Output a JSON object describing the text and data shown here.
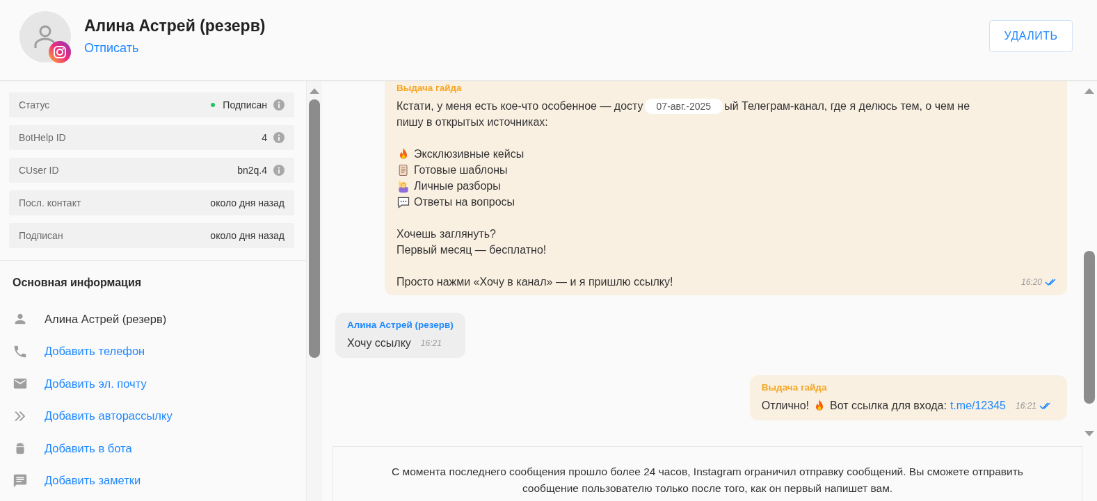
{
  "contact": {
    "name": "Алина Астрей (резерв)",
    "unsubscribe": "Отписать",
    "delete_button": "УДАЛИТЬ"
  },
  "attributes": [
    {
      "kind": "status",
      "label": "Статус",
      "value": "Подписан",
      "info": true
    },
    {
      "kind": "plain",
      "label": "BotHelp ID",
      "value": "4",
      "info": true
    },
    {
      "kind": "plain",
      "label": "CUser ID",
      "value": "bn2q.4",
      "info": true
    },
    {
      "kind": "plain",
      "label": "Посл. контакт",
      "value": "около дня назад",
      "info": false
    },
    {
      "kind": "plain",
      "label": "Подписан",
      "value": "около дня назад",
      "info": false
    }
  ],
  "basic_info": {
    "title": "Основная информация",
    "items": [
      {
        "kind": "person",
        "text": "Алина Астрей (резерв)",
        "link": false
      },
      {
        "kind": "phone",
        "text": "Добавить телефон",
        "link": true
      },
      {
        "kind": "email",
        "text": "Добавить эл. почту",
        "link": true
      },
      {
        "kind": "autosend",
        "text": "Добавить авторассылку",
        "link": true
      },
      {
        "kind": "bot",
        "text": "Добавить в бота",
        "link": true
      },
      {
        "kind": "note",
        "text": "Добавить заметки",
        "link": true
      }
    ]
  },
  "chat": {
    "messages": [
      {
        "outgoing": true,
        "sender": "Выдача гайда",
        "time": "16:20",
        "read": true,
        "paragraphs": [
          [
            {
              "parts": [
                {
                  "kind": "text",
                  "text": "Кстати, у меня есть кое-что особенное — досту"
                },
                {
                  "kind": "date",
                  "text": "07-авг.-2025"
                },
                {
                  "kind": "text",
                  "text": "ый Телеграм-канал, где я делюсь тем, о чем не"
                }
              ]
            },
            {
              "parts": [
                {
                  "kind": "text",
                  "text": "пишу в открытых источниках:"
                }
              ]
            }
          ],
          [
            {
              "parts": [
                {
                  "kind": "fire"
                },
                {
                  "kind": "text",
                  "text": "Эксклюзивные кейсы"
                }
              ]
            },
            {
              "parts": [
                {
                  "kind": "scroll"
                },
                {
                  "kind": "text",
                  "text": "Готовые шаблоны"
                }
              ]
            },
            {
              "parts": [
                {
                  "kind": "hand"
                },
                {
                  "kind": "text",
                  "text": "Личные разборы"
                }
              ]
            },
            {
              "parts": [
                {
                  "kind": "speech"
                },
                {
                  "kind": "text",
                  "text": "Ответы на вопросы"
                }
              ]
            }
          ],
          [
            {
              "parts": [
                {
                  "kind": "text",
                  "text": "Хочешь заглянуть?"
                }
              ]
            },
            {
              "parts": [
                {
                  "kind": "text",
                  "text": "Первый месяц — бесплатно!"
                }
              ]
            }
          ],
          [
            {
              "parts": [
                {
                  "kind": "text",
                  "text": "Просто нажми «Хочу в канал» — и я пришлю ссылку!"
                }
              ]
            }
          ]
        ]
      },
      {
        "outgoing": false,
        "sender": "Алина Астрей (резерв)",
        "time": "16:21",
        "paragraphs": [
          [
            {
              "parts": [
                {
                  "kind": "text",
                  "text": "Хочу ссылку"
                }
              ]
            }
          ]
        ]
      },
      {
        "outgoing": true,
        "sender": "Выдача гайда",
        "time": "16:21",
        "read": true,
        "paragraphs": [
          [
            {
              "parts": [
                {
                  "kind": "text",
                  "text": "Отлично!"
                },
                {
                  "kind": "fire"
                },
                {
                  "kind": "text",
                  "text": "Вот ссылка для входа:"
                },
                {
                  "kind": "link",
                  "text": "t.me/12345"
                }
              ]
            }
          ]
        ]
      }
    ],
    "notice": "С момента последнего сообщения прошло более 24 часов, Instagram ограничил отправку сообщений. Вы сможете отправить сообщение пользователю только после того, как он первый напишет вам."
  }
}
